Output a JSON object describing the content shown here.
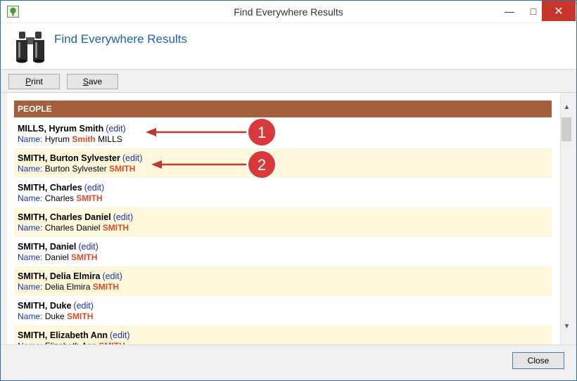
{
  "window": {
    "title": "Find Everywhere Results",
    "minimize_glyph": "—",
    "maximize_glyph": "□",
    "close_glyph": "✕"
  },
  "header": {
    "title": "Find Everywhere Results",
    "icon": "binoculars-icon"
  },
  "toolbar": {
    "print_access_key": "P",
    "print_rest": "rint",
    "save_access_key": "S",
    "save_rest": "ave"
  },
  "section": {
    "title": "PEOPLE"
  },
  "results": [
    {
      "name": "MILLS, Hyrum Smith",
      "edit": "(edit)",
      "label": "Name:",
      "before": "Hyrum",
      "match": "Smith",
      "after": "MILLS"
    },
    {
      "name": "SMITH, Burton Sylvester",
      "edit": "(edit)",
      "label": "Name:",
      "before": "Burton Sylvester",
      "match": "SMITH",
      "after": ""
    },
    {
      "name": "SMITH, Charles",
      "edit": "(edit)",
      "label": "Name:",
      "before": "Charles",
      "match": "SMITH",
      "after": ""
    },
    {
      "name": "SMITH, Charles Daniel",
      "edit": "(edit)",
      "label": "Name:",
      "before": "Charles Daniel",
      "match": "SMITH",
      "after": ""
    },
    {
      "name": "SMITH, Daniel",
      "edit": "(edit)",
      "label": "Name:",
      "before": "Daniel",
      "match": "SMITH",
      "after": ""
    },
    {
      "name": "SMITH, Delia Elmira",
      "edit": "(edit)",
      "label": "Name:",
      "before": "Delia Elmira",
      "match": "SMITH",
      "after": ""
    },
    {
      "name": "SMITH, Duke",
      "edit": "(edit)",
      "label": "Name:",
      "before": "Duke",
      "match": "SMITH",
      "after": ""
    },
    {
      "name": "SMITH, Elizabeth Ann",
      "edit": "(edit)",
      "label": "Name:",
      "before": "Elizabeth Ann",
      "match": "SMITH",
      "after": ""
    }
  ],
  "footer": {
    "close_label": "Close"
  },
  "callouts": [
    {
      "number": "1"
    },
    {
      "number": "2"
    }
  ],
  "colors": {
    "section_header": "#a35e3c",
    "alt_row": "#fdf7db",
    "highlight": "#e04a2c",
    "link": "#1c32b5",
    "callout": "#d9393a",
    "accent_title": "#1c63b4"
  }
}
